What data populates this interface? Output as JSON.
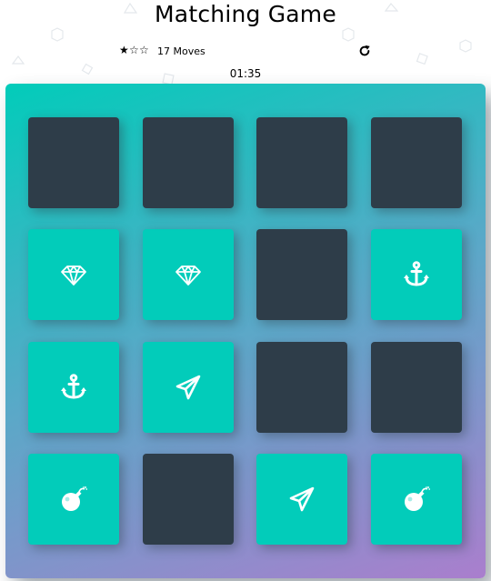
{
  "header": {
    "title": "Matching Game"
  },
  "score_panel": {
    "stars": [
      "filled",
      "empty",
      "empty"
    ],
    "moves_label": "17 Moves",
    "timer": "01:35"
  },
  "colors": {
    "card_closed": "#2e3d49",
    "card_matched": "#02ccba",
    "deck_gradient_start": "#02ccba",
    "deck_gradient_end": "#aa7ecd"
  },
  "deck": {
    "columns": 4,
    "cards": [
      {
        "state": "closed",
        "icon": ""
      },
      {
        "state": "closed",
        "icon": ""
      },
      {
        "state": "closed",
        "icon": ""
      },
      {
        "state": "closed",
        "icon": ""
      },
      {
        "state": "match",
        "icon": "diamond-icon"
      },
      {
        "state": "match",
        "icon": "diamond-icon"
      },
      {
        "state": "closed",
        "icon": ""
      },
      {
        "state": "match",
        "icon": "anchor-icon"
      },
      {
        "state": "match",
        "icon": "anchor-icon"
      },
      {
        "state": "match",
        "icon": "paper-plane-icon"
      },
      {
        "state": "closed",
        "icon": ""
      },
      {
        "state": "closed",
        "icon": ""
      },
      {
        "state": "match",
        "icon": "bomb-icon"
      },
      {
        "state": "closed",
        "icon": ""
      },
      {
        "state": "match",
        "icon": "paper-plane-icon"
      },
      {
        "state": "match",
        "icon": "bomb-icon"
      }
    ]
  }
}
